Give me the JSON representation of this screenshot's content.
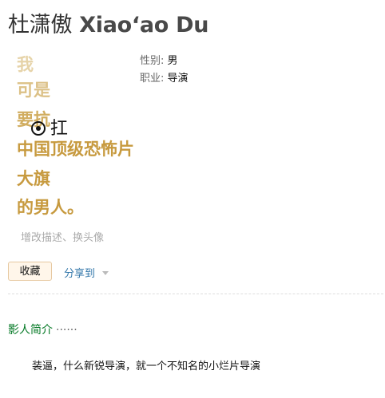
{
  "header": {
    "name_cn": "杜潇傲",
    "name_en": "Xiao‘ao Du"
  },
  "poster": {
    "lines": [
      "我",
      "可是",
      "要抗",
      "中国顶级恐怖片",
      "大旗",
      "的男人。"
    ],
    "graffiti": "扛"
  },
  "edit_link": "增改描述、换头像",
  "info": {
    "gender_label": "性别:",
    "gender_value": "男",
    "job_label": "职业:",
    "job_value": "导演"
  },
  "actions": {
    "collect_label": "收藏",
    "share_label": "分享到"
  },
  "intro": {
    "heading": "影人简介",
    "dots": "······",
    "text": "装逼，什么新锐导演，就一个不知名的小烂片导演"
  },
  "colors": {
    "link": "#3377aa",
    "heading_green": "#007722",
    "poster_gold": "#c79a3f"
  }
}
